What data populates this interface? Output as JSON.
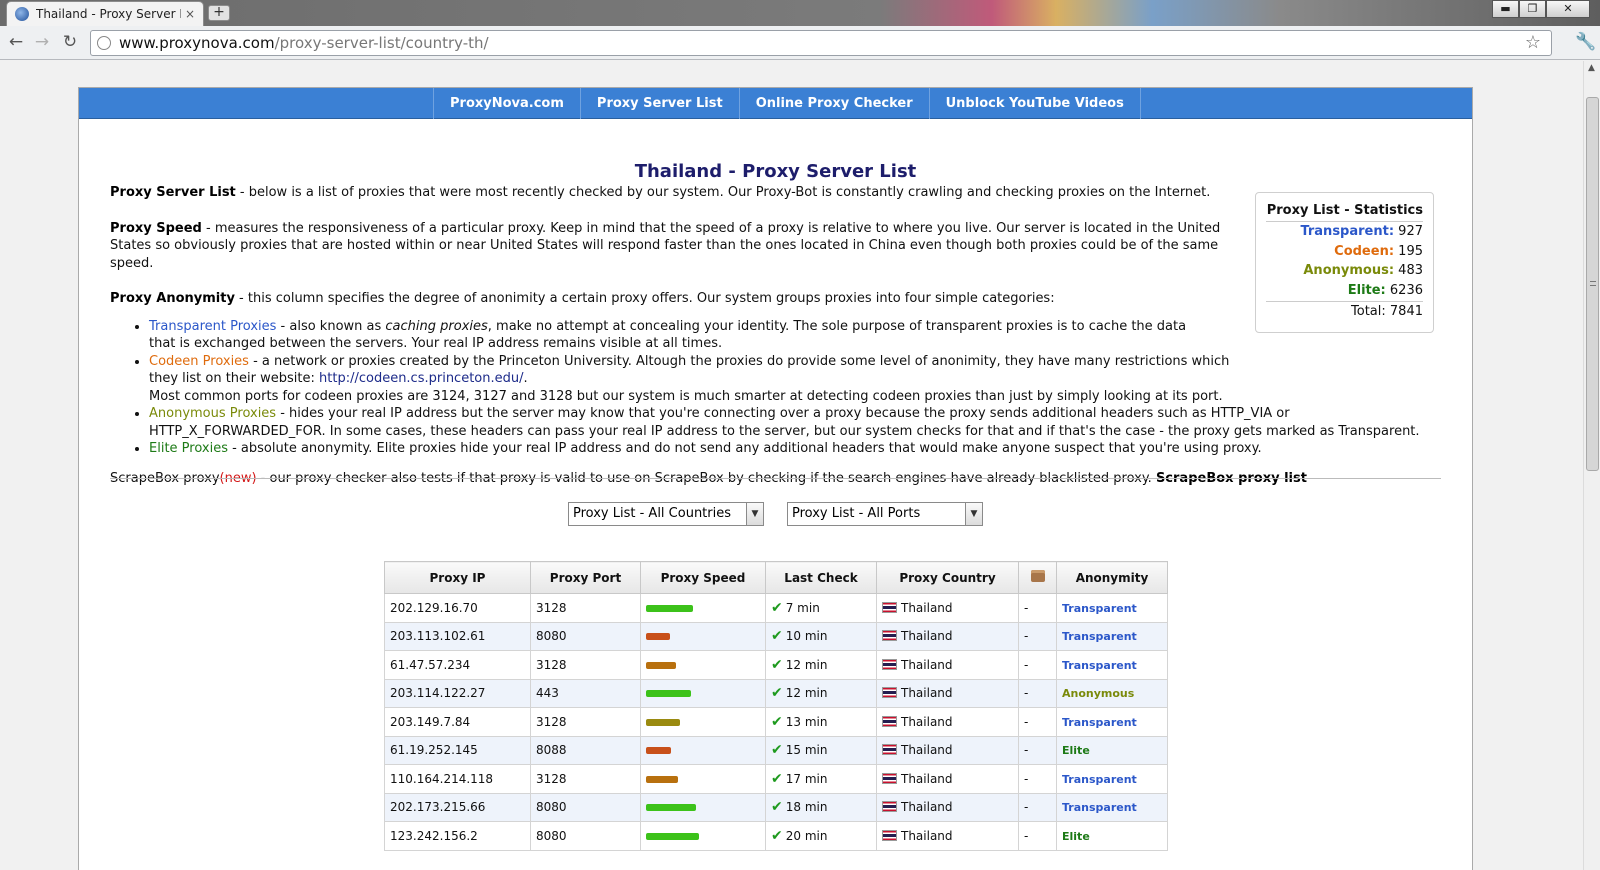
{
  "browser": {
    "tab_title": "Thailand - Proxy Server List",
    "tab_close": "×",
    "new_tab": "+",
    "url_host": "www.proxynova.com",
    "url_path": "/proxy-server-list/country-th/",
    "win_min": "▬",
    "win_max": "❐",
    "win_close": "✕"
  },
  "nav": {
    "items": [
      "ProxyNova.com",
      "Proxy Server List",
      "Online Proxy Checker",
      "Unblock YouTube Videos"
    ]
  },
  "page": {
    "title": "Thailand - Proxy Server List",
    "p1_label": "Proxy Server List",
    "p1_text": " - below is a list of proxies that were most recently checked by our system. Our Proxy-Bot is constantly crawling and checking proxies on the Internet.",
    "p2_label": "Proxy Speed",
    "p2_text": " - measures the responsiveness of a particular proxy. Keep in mind that the speed of a proxy is relative to where you live. Our server is located in the United States so obviously proxies that are hosted within or near United States will respond faster than the ones located in China even though both proxies could be of the same speed.",
    "p3_label": "Proxy Anonymity",
    "p3_text": " - this column specifies the degree of anonimity a certain proxy offers. Our system groups proxies into four simple categories:",
    "li1_label": "Transparent Proxies",
    "li1_a": " - also known as ",
    "li1_em": "caching proxies",
    "li1_b": ", make no attempt at concealing your identity. The sole purpose of transparent proxies is to cache the data that is exchanged between the servers. Your real IP address remains visible at all times.",
    "li2_label": "Codeen Proxies",
    "li2_a": " - a network or proxies created by the Princeton University. Altough the proxies do provide some level of anonimity, they have many restrictions which they list on their website: ",
    "li2_link": "http://codeen.cs.princeton.edu/",
    "li2_b": ".",
    "li2_c": "Most common ports for codeen proxies are 3124, 3127 and 3128 but our system is much smarter at detecting codeen proxies than just by simply looking at its port.",
    "li3_label": "Anonymous Proxies",
    "li3_text": " - hides your real IP address but the server may know that you're connecting over a proxy because the proxy sends additional headers such as HTTP_VIA or HTTP_X_FORWARDED_FOR. In some cases, these headers can pass your real IP address to the server, but our system checks for that and if that's the case - the proxy gets marked as Transparent.",
    "li4_label": "Elite Proxies",
    "li4_text": " - absolute anonymity. Elite proxies hide your real IP address and do not send any additional headers that would make anyone suspect that you're using proxy.",
    "sb_a": "ScrapeBox proxy",
    "sb_new": "(new)",
    "sb_b": " - our proxy checker also tests if that proxy is valid to use on ScrapeBox by checking if the search engines have already blacklisted proxy. ",
    "sb_link": "ScrapeBox proxy list"
  },
  "stats": {
    "title": "Proxy List - Statistics",
    "transparent_label": "Transparent:",
    "transparent_value": "927",
    "codeen_label": "Codeen:",
    "codeen_value": "195",
    "anonymous_label": "Anonymous:",
    "anonymous_value": "483",
    "elite_label": "Elite:",
    "elite_value": "6236",
    "total_label": "Total:",
    "total_value": "7841"
  },
  "filters": {
    "country": "Proxy List - All Countries",
    "port": "Proxy List - All Ports"
  },
  "table": {
    "headers": [
      "Proxy IP",
      "Proxy Port",
      "Proxy Speed",
      "Last Check",
      "Proxy Country",
      "",
      "Anonymity"
    ],
    "rows": [
      {
        "ip": "202.129.16.70",
        "port": "3128",
        "speed": 0.78,
        "speed_color": "#3cc21a",
        "check": "7 min",
        "country": "Thailand",
        "extra": "-",
        "anon": "Transparent",
        "anon_class": "anon-trans"
      },
      {
        "ip": "203.113.102.61",
        "port": "8080",
        "speed": 0.4,
        "speed_color": "#c8501a",
        "check": "10 min",
        "country": "Thailand",
        "extra": "-",
        "anon": "Transparent",
        "anon_class": "anon-trans"
      },
      {
        "ip": "61.47.57.234",
        "port": "3128",
        "speed": 0.5,
        "speed_color": "#b8700e",
        "check": "12 min",
        "country": "Thailand",
        "extra": "-",
        "anon": "Transparent",
        "anon_class": "anon-trans"
      },
      {
        "ip": "203.114.122.27",
        "port": "443",
        "speed": 0.75,
        "speed_color": "#3cc21a",
        "check": "12 min",
        "country": "Thailand",
        "extra": "-",
        "anon": "Anonymous",
        "anon_class": "anon-anon"
      },
      {
        "ip": "203.149.7.84",
        "port": "3128",
        "speed": 0.56,
        "speed_color": "#9a8a10",
        "check": "13 min",
        "country": "Thailand",
        "extra": "-",
        "anon": "Transparent",
        "anon_class": "anon-trans"
      },
      {
        "ip": "61.19.252.145",
        "port": "8088",
        "speed": 0.42,
        "speed_color": "#c8501a",
        "check": "15 min",
        "country": "Thailand",
        "extra": "-",
        "anon": "Elite",
        "anon_class": "anon-elite"
      },
      {
        "ip": "110.164.214.118",
        "port": "3128",
        "speed": 0.53,
        "speed_color": "#b8700e",
        "check": "17 min",
        "country": "Thailand",
        "extra": "-",
        "anon": "Transparent",
        "anon_class": "anon-trans"
      },
      {
        "ip": "202.173.215.66",
        "port": "8080",
        "speed": 0.84,
        "speed_color": "#3cc21a",
        "check": "18 min",
        "country": "Thailand",
        "extra": "-",
        "anon": "Transparent",
        "anon_class": "anon-trans"
      },
      {
        "ip": "123.242.156.2",
        "port": "8080",
        "speed": 0.89,
        "speed_color": "#3cc21a",
        "check": "20 min",
        "country": "Thailand",
        "extra": "-",
        "anon": "Elite",
        "anon_class": "anon-elite"
      }
    ]
  },
  "icons": {
    "back": "arrow-left-icon",
    "forward": "arrow-right-icon",
    "reload": "reload-icon",
    "bookmark": "star-icon",
    "settings": "wrench-icon",
    "check": "checkmark-icon",
    "flag": "thailand-flag-icon",
    "box": "box-icon"
  }
}
